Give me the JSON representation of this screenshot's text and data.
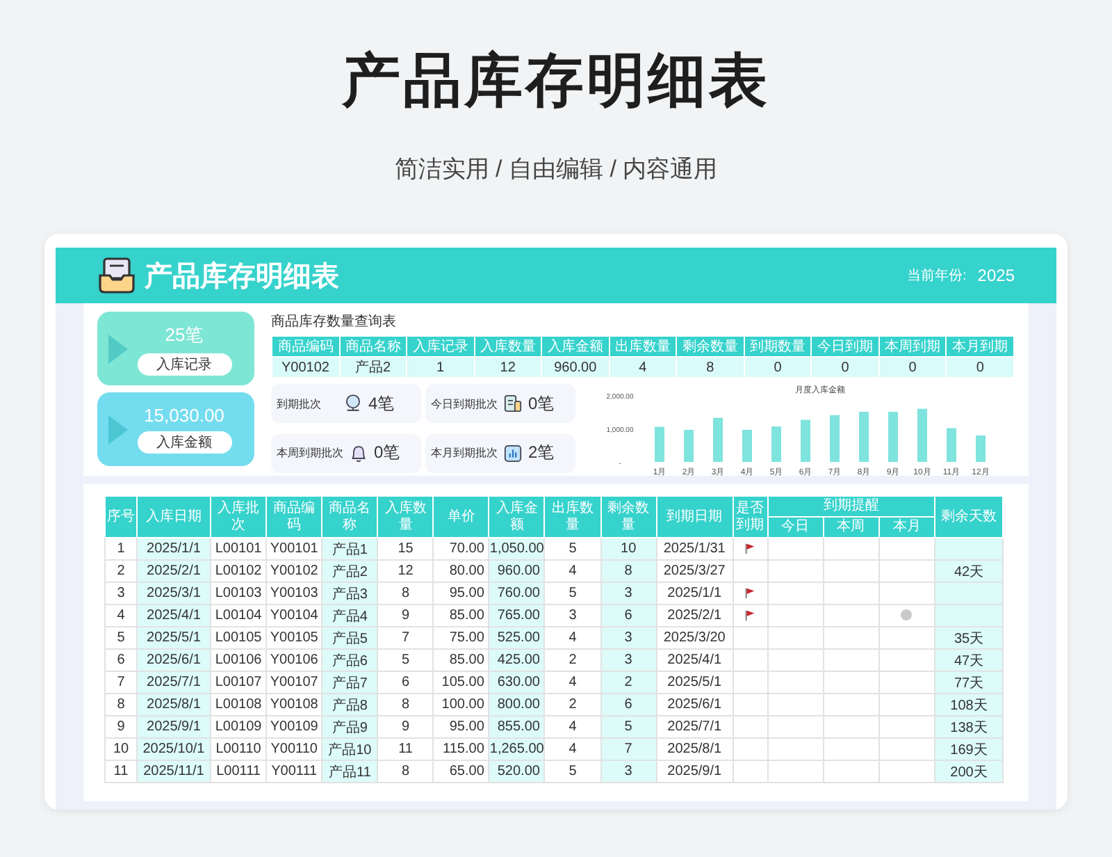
{
  "title": "产品库存明细表",
  "subtitle": "简洁实用 / 自由编辑 / 内容通用",
  "header": {
    "title": "产品库存明细表",
    "year_label": "当前年份:",
    "year": "2025"
  },
  "summary_tiles": [
    {
      "value": "25笔",
      "label": "入库记录"
    },
    {
      "value": "15,030.00",
      "label": "入库金额"
    }
  ],
  "query_table": {
    "title": "商品库存数量查询表",
    "columns": [
      "商品编码",
      "商品名称",
      "入库记录",
      "入库数量",
      "入库金额",
      "出库数量",
      "剩余数量",
      "到期数量",
      "今日到期",
      "本周到期",
      "本月到期"
    ],
    "row": [
      "Y00102",
      "产品2",
      "1",
      "12",
      "960.00",
      "4",
      "8",
      "0",
      "0",
      "0",
      "0"
    ]
  },
  "due_stats": [
    {
      "label": "到期批次",
      "value": "4笔"
    },
    {
      "label": "今日到期批次",
      "value": "0笔"
    },
    {
      "label": "本周到期批次",
      "value": "0笔"
    },
    {
      "label": "本月到期批次",
      "value": "2笔"
    }
  ],
  "chart": {
    "chart_data": {
      "type": "bar",
      "title": "月度入库金额",
      "categories": [
        "1月",
        "2月",
        "3月",
        "4月",
        "5月",
        "6月",
        "7月",
        "8月",
        "9月",
        "10月",
        "11月",
        "12月"
      ],
      "series": [
        {
          "color": "#7fe3de",
          "values": [
            1050,
            960,
            1320,
            960,
            1060,
            1260,
            1400,
            1500,
            1500,
            1590,
            1010,
            790
          ]
        }
      ],
      "ylim": [
        0,
        2000
      ],
      "yticks": [
        {
          "value": 0,
          "label": "-"
        },
        {
          "value": 1000,
          "label": "1,000.00"
        },
        {
          "value": 2000,
          "label": "2,000.00"
        }
      ]
    }
  },
  "detail_table": {
    "columns": [
      "序号",
      "入库日期",
      "入库批次",
      "商品编码",
      "商品名称",
      "入库数量",
      "单价",
      "入库金额",
      "出库数量",
      "剩余数量",
      "到期日期"
    ],
    "expired_label": "是否到期",
    "reminder_label": "到期提醒",
    "reminder_columns": [
      "今日",
      "本周",
      "本月"
    ],
    "days_label": "剩余天数",
    "rows": [
      {
        "cells": [
          "1",
          "2025/1/1",
          "L00101",
          "Y00101",
          "产品1",
          "15",
          "70.00",
          "1,050.00",
          "5",
          "10",
          "2025/1/31"
        ],
        "expired": true,
        "due_today": false,
        "due_week": false,
        "due_month": false
      },
      {
        "cells": [
          "2",
          "2025/2/1",
          "L00102",
          "Y00102",
          "产品2",
          "12",
          "80.00",
          "960.00",
          "4",
          "8",
          "2025/3/27"
        ],
        "expired": false,
        "due_today": false,
        "due_week": false,
        "due_month": false,
        "days_left": "42天"
      },
      {
        "cells": [
          "3",
          "2025/3/1",
          "L00103",
          "Y00103",
          "产品3",
          "8",
          "95.00",
          "760.00",
          "5",
          "3",
          "2025/1/1"
        ],
        "expired": true,
        "due_today": false,
        "due_week": false,
        "due_month": false
      },
      {
        "cells": [
          "4",
          "2025/4/1",
          "L00104",
          "Y00104",
          "产品4",
          "9",
          "85.00",
          "765.00",
          "3",
          "6",
          "2025/2/1"
        ],
        "expired": true,
        "due_today": false,
        "due_week": false,
        "due_month": true
      },
      {
        "cells": [
          "5",
          "2025/5/1",
          "L00105",
          "Y00105",
          "产品5",
          "7",
          "75.00",
          "525.00",
          "4",
          "3",
          "2025/3/20"
        ],
        "expired": false,
        "due_today": false,
        "due_week": false,
        "due_month": false,
        "days_left": "35天"
      },
      {
        "cells": [
          "6",
          "2025/6/1",
          "L00106",
          "Y00106",
          "产品6",
          "5",
          "85.00",
          "425.00",
          "2",
          "3",
          "2025/4/1"
        ],
        "expired": false,
        "due_today": false,
        "due_week": false,
        "due_month": false,
        "days_left": "47天"
      },
      {
        "cells": [
          "7",
          "2025/7/1",
          "L00107",
          "Y00107",
          "产品7",
          "6",
          "105.00",
          "630.00",
          "4",
          "2",
          "2025/5/1"
        ],
        "expired": false,
        "due_today": false,
        "due_week": false,
        "due_month": false,
        "days_left": "77天"
      },
      {
        "cells": [
          "8",
          "2025/8/1",
          "L00108",
          "Y00108",
          "产品8",
          "8",
          "100.00",
          "800.00",
          "2",
          "6",
          "2025/6/1"
        ],
        "expired": false,
        "due_today": false,
        "due_week": false,
        "due_month": false,
        "days_left": "108天"
      },
      {
        "cells": [
          "9",
          "2025/9/1",
          "L00109",
          "Y00109",
          "产品9",
          "9",
          "95.00",
          "855.00",
          "4",
          "5",
          "2025/7/1"
        ],
        "expired": false,
        "due_today": false,
        "due_week": false,
        "due_month": false,
        "days_left": "138天"
      },
      {
        "cells": [
          "10",
          "2025/10/1",
          "L00110",
          "Y00110",
          "产品10",
          "11",
          "115.00",
          "1,265.00",
          "4",
          "7",
          "2025/8/1"
        ],
        "expired": false,
        "due_today": false,
        "due_week": false,
        "due_month": false,
        "days_left": "169天"
      },
      {
        "cells": [
          "11",
          "2025/11/1",
          "L00111",
          "Y00111",
          "产品11",
          "8",
          "65.00",
          "520.00",
          "5",
          "3",
          "2025/9/1"
        ],
        "expired": false,
        "due_today": false,
        "due_week": false,
        "due_month": false,
        "days_left": "200天"
      }
    ]
  }
}
